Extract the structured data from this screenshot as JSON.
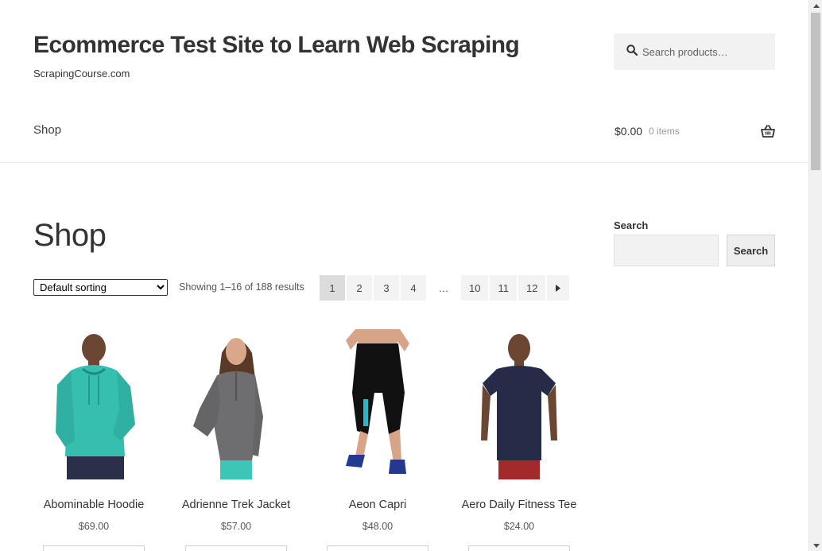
{
  "header": {
    "site_title": "Ecommerce Test Site to Learn Web Scraping",
    "site_description": "ScrapingCourse.com",
    "search_placeholder": "Search products…",
    "nav_shop": "Shop",
    "cart_amount": "$0.00",
    "cart_count": "0 items"
  },
  "main": {
    "page_title": "Shop",
    "sorting_selected": "Default sorting",
    "result_count": "Showing 1–16 of 188 results",
    "pagination": [
      "1",
      "2",
      "3",
      "4",
      "…",
      "10",
      "11",
      "12"
    ],
    "products": [
      {
        "name": "Abominable Hoodie",
        "price": "$69.00"
      },
      {
        "name": "Adrienne Trek Jacket",
        "price": "$57.00"
      },
      {
        "name": "Aeon Capri",
        "price": "$48.00"
      },
      {
        "name": "Aero Daily Fitness Tee",
        "price": "$24.00"
      }
    ]
  },
  "sidebar": {
    "search_title": "Search",
    "search_button": "Search"
  },
  "colors": {
    "text_dark": "#333333",
    "input_bg": "#f2f2f2",
    "page_current_bg": "#dcdcdc"
  }
}
